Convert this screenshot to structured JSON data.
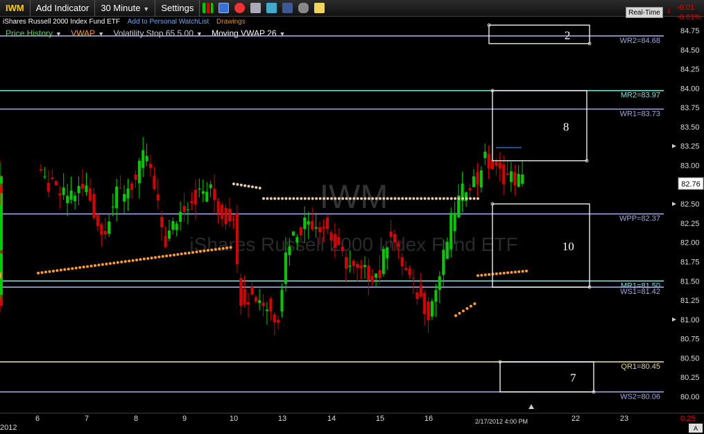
{
  "toolbar": {
    "symbol": "IWM",
    "add_indicator": "Add Indicator",
    "interval": "30 Minute",
    "settings": "Settings",
    "realtime": "Real-Time",
    "change": "-0.01",
    "change_pct": "-0.01%",
    "icons": [
      "bar-chart-icon",
      "save-icon",
      "alarm-icon",
      "print-icon",
      "twitter-icon",
      "facebook-icon",
      "binoculars-icon",
      "note-icon"
    ]
  },
  "subtitle": {
    "fund_name": "iShares Russell 2000 Index Fund ETF",
    "watchlist_link": "Add to Personal WatchList",
    "drawings_link": "Drawings"
  },
  "indicators": [
    "Price History",
    "VWAP",
    "Volatility Stop 65 5.00",
    "Moving VWAP 26"
  ],
  "colors": {
    "up_candle": "#00cc00",
    "down_candle": "#dd0000",
    "vwap": "#ff9c2a",
    "moving_vwap": "#ffffff",
    "volatility_stop_low": "#ff9c2a",
    "volatility_stop_high": "#e8c9a8",
    "pivot_blue": "#9fa8e0",
    "pivot_teal": "#7fe0d8",
    "pivot_yellow": "#e0d890"
  },
  "chart_data": {
    "type": "candlestick",
    "watermark_symbol": "IWM",
    "watermark_name": "iShares Russell 2000 Index Fund ETF",
    "ylim": [
      79.9,
      84.9
    ],
    "yticks": [
      "84.75",
      "84.50",
      "84.25",
      "84.00",
      "83.75",
      "83.50",
      "83.25",
      "83.00",
      "82.75",
      "82.50",
      "82.25",
      "82.00",
      "81.75",
      "81.50",
      "81.25",
      "81.00",
      "80.75",
      "80.50",
      "80.25",
      "80.00",
      "0.25"
    ],
    "xtick_labels": [
      "6",
      "7",
      "8",
      "9",
      "10",
      "13",
      "14",
      "15",
      "16",
      "22",
      "23"
    ],
    "year_label": "2012",
    "cursor_label": "2/17/2012 4:00 PM",
    "last_price": "82.76",
    "pivot_levels": [
      {
        "label": "WR2=84.68",
        "value": 84.68,
        "color": "#9fa8e0"
      },
      {
        "label": "MR2=83.97",
        "value": 83.97,
        "color": "#7fe0d8"
      },
      {
        "label": "WR1=83.73",
        "value": 83.73,
        "color": "#9fa8e0"
      },
      {
        "label": "WPP=82.37",
        "value": 82.37,
        "color": "#9fa8e0"
      },
      {
        "label": "MR1=81.50",
        "value": 81.5,
        "color": "#7fe0d8"
      },
      {
        "label": "WS1=81.42",
        "value": 81.42,
        "color": "#9fa8e0"
      },
      {
        "label": "QR1=80.45",
        "value": 80.45,
        "color": "#e0d890"
      },
      {
        "label": "WS2=80.06",
        "value": 80.06,
        "color": "#9fa8e0"
      }
    ],
    "drawn_boxes": [
      {
        "label": "2",
        "ylow": 84.58,
        "yhigh": 84.82,
        "slot": 99.9
      },
      {
        "label": "8",
        "ylow": 83.06,
        "yhigh": 83.97,
        "slot": 100.5
      },
      {
        "label": "10",
        "ylow": 81.42,
        "yhigh": 82.5,
        "slot": 100.5
      },
      {
        "label": "7",
        "ylow": 80.06,
        "yhigh": 80.45,
        "slot": 101.2
      }
    ],
    "price_axis_markers": [
      "83.25",
      "82.50",
      "81.00"
    ]
  }
}
